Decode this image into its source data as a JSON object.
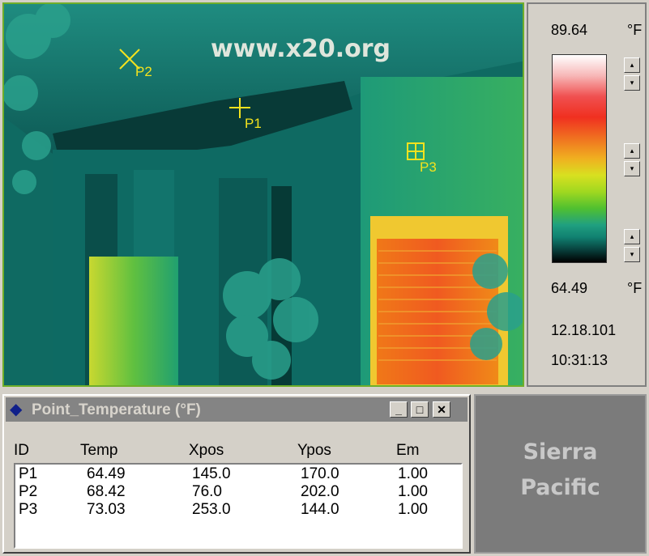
{
  "thermal_image": {
    "watermark": "www.x20.org",
    "markers": [
      {
        "label": "P1",
        "shape": "crosshair"
      },
      {
        "label": "P2",
        "shape": "x-mark"
      },
      {
        "label": "P3",
        "shape": "box-cross"
      }
    ]
  },
  "palette": {
    "max_temp": "89.64",
    "min_temp": "64.49",
    "unit": "°F",
    "date": "12.18.101",
    "time": "10:31:13",
    "colors": [
      "#ffffff",
      "#f05050",
      "#f07020",
      "#f0b020",
      "#a0d820",
      "#20a080",
      "#000000"
    ]
  },
  "point_window": {
    "title": "Point_Temperature (°F)",
    "buttons": {
      "minimize": "_",
      "maximize": "□",
      "close": "✕"
    },
    "columns": [
      "ID",
      "Temp",
      "Xpos",
      "Ypos",
      "Em"
    ],
    "rows": [
      {
        "id": "P1",
        "temp": "64.49",
        "xpos": "145.0",
        "ypos": "170.0",
        "em": "1.00"
      },
      {
        "id": "P2",
        "temp": "68.42",
        "xpos": "76.0",
        "ypos": "202.0",
        "em": "1.00"
      },
      {
        "id": "P3",
        "temp": "73.03",
        "xpos": "253.0",
        "ypos": "144.0",
        "em": "1.00"
      }
    ]
  },
  "brand": {
    "line1": "Sierra",
    "line2": "Pacific"
  }
}
